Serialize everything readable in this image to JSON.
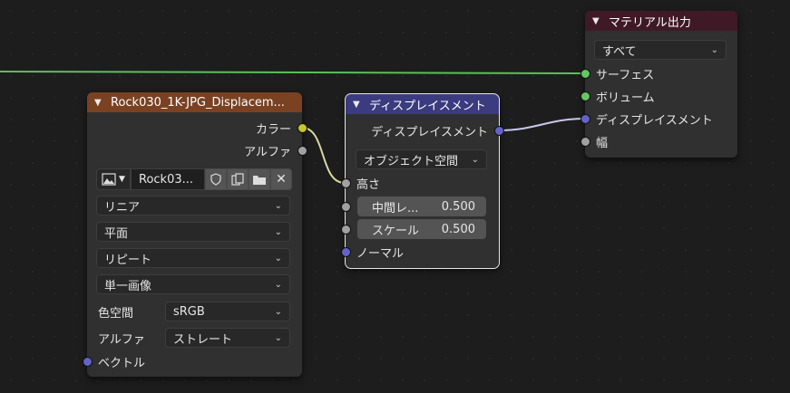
{
  "colors": {
    "texture_header": "#7a4222",
    "vector_header": "#3b3b80",
    "output_header": "#3f1a26",
    "link_green": "#5cbf5c",
    "link_yellow": "#d8d8a0",
    "link_purple": "#c8c8f0"
  },
  "image_texture": {
    "title": "Rock030_1K-JPG_Displacem...",
    "outputs": [
      "カラー",
      "アルファ"
    ],
    "image_name": "Rock03...",
    "interpolation": "リニア",
    "projection": "平面",
    "extension": "リピート",
    "source": "単一画像",
    "color_space_label": "色空間",
    "color_space": "sRGB",
    "alpha_label": "アルファ",
    "alpha_mode": "ストレート",
    "vector_input": "ベクトル"
  },
  "displacement": {
    "title": "ディスプレイスメント",
    "output": "ディスプレイスメント",
    "space": "オブジェクト空間",
    "height": "高さ",
    "midlevel_label": "中間レ...",
    "midlevel_value": "0.500",
    "scale_label": "スケール",
    "scale_value": "0.500",
    "normal": "ノーマル"
  },
  "material_output": {
    "title": "マテリアル出力",
    "target": "すべて",
    "inputs": [
      "サーフェス",
      "ボリューム",
      "ディスプレイスメント",
      "幅"
    ]
  },
  "icons": {
    "header_chevron": "chevron-down-icon",
    "image_type": "image-icon",
    "fake_user": "shield-icon",
    "duplicate": "duplicate-icon",
    "open": "folder-icon",
    "unlink": "close-icon"
  }
}
